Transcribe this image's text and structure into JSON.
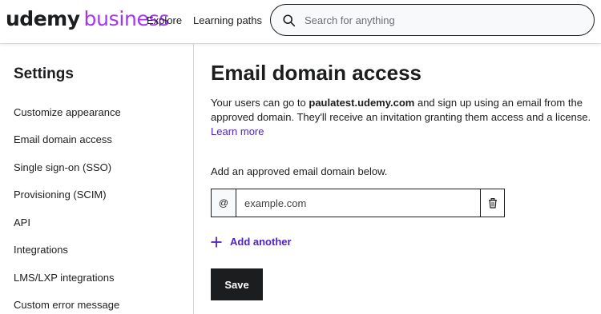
{
  "header": {
    "logo_primary": "udemy",
    "logo_secondary": "business",
    "nav": [
      "Explore",
      "Learning paths"
    ],
    "search_placeholder": "Search for anything"
  },
  "sidebar": {
    "title": "Settings",
    "items": [
      "Customize appearance",
      "Email domain access",
      "Single sign-on (SSO)",
      "Provisioning (SCIM)",
      "API",
      "Integrations",
      "LMS/LXP integrations",
      "Custom error message"
    ]
  },
  "main": {
    "title": "Email domain access",
    "desc_prefix": "Your users can go to ",
    "desc_domain": "paulatest.udemy.com",
    "desc_suffix": " and sign up using an email from the approved domain. They'll receive an invitation granting them access and a license.",
    "learn_more": "Learn more",
    "field_label": "Add an approved email domain below.",
    "at_symbol": "@",
    "domain_placeholder": "example.com",
    "add_another": "Add another",
    "save": "Save"
  },
  "colors": {
    "brand_purple": "#a435f0",
    "link_purple": "#5022c3",
    "text_dark": "#1c1d1f"
  },
  "icons": [
    "search-icon",
    "trash-icon",
    "plus-icon"
  ]
}
